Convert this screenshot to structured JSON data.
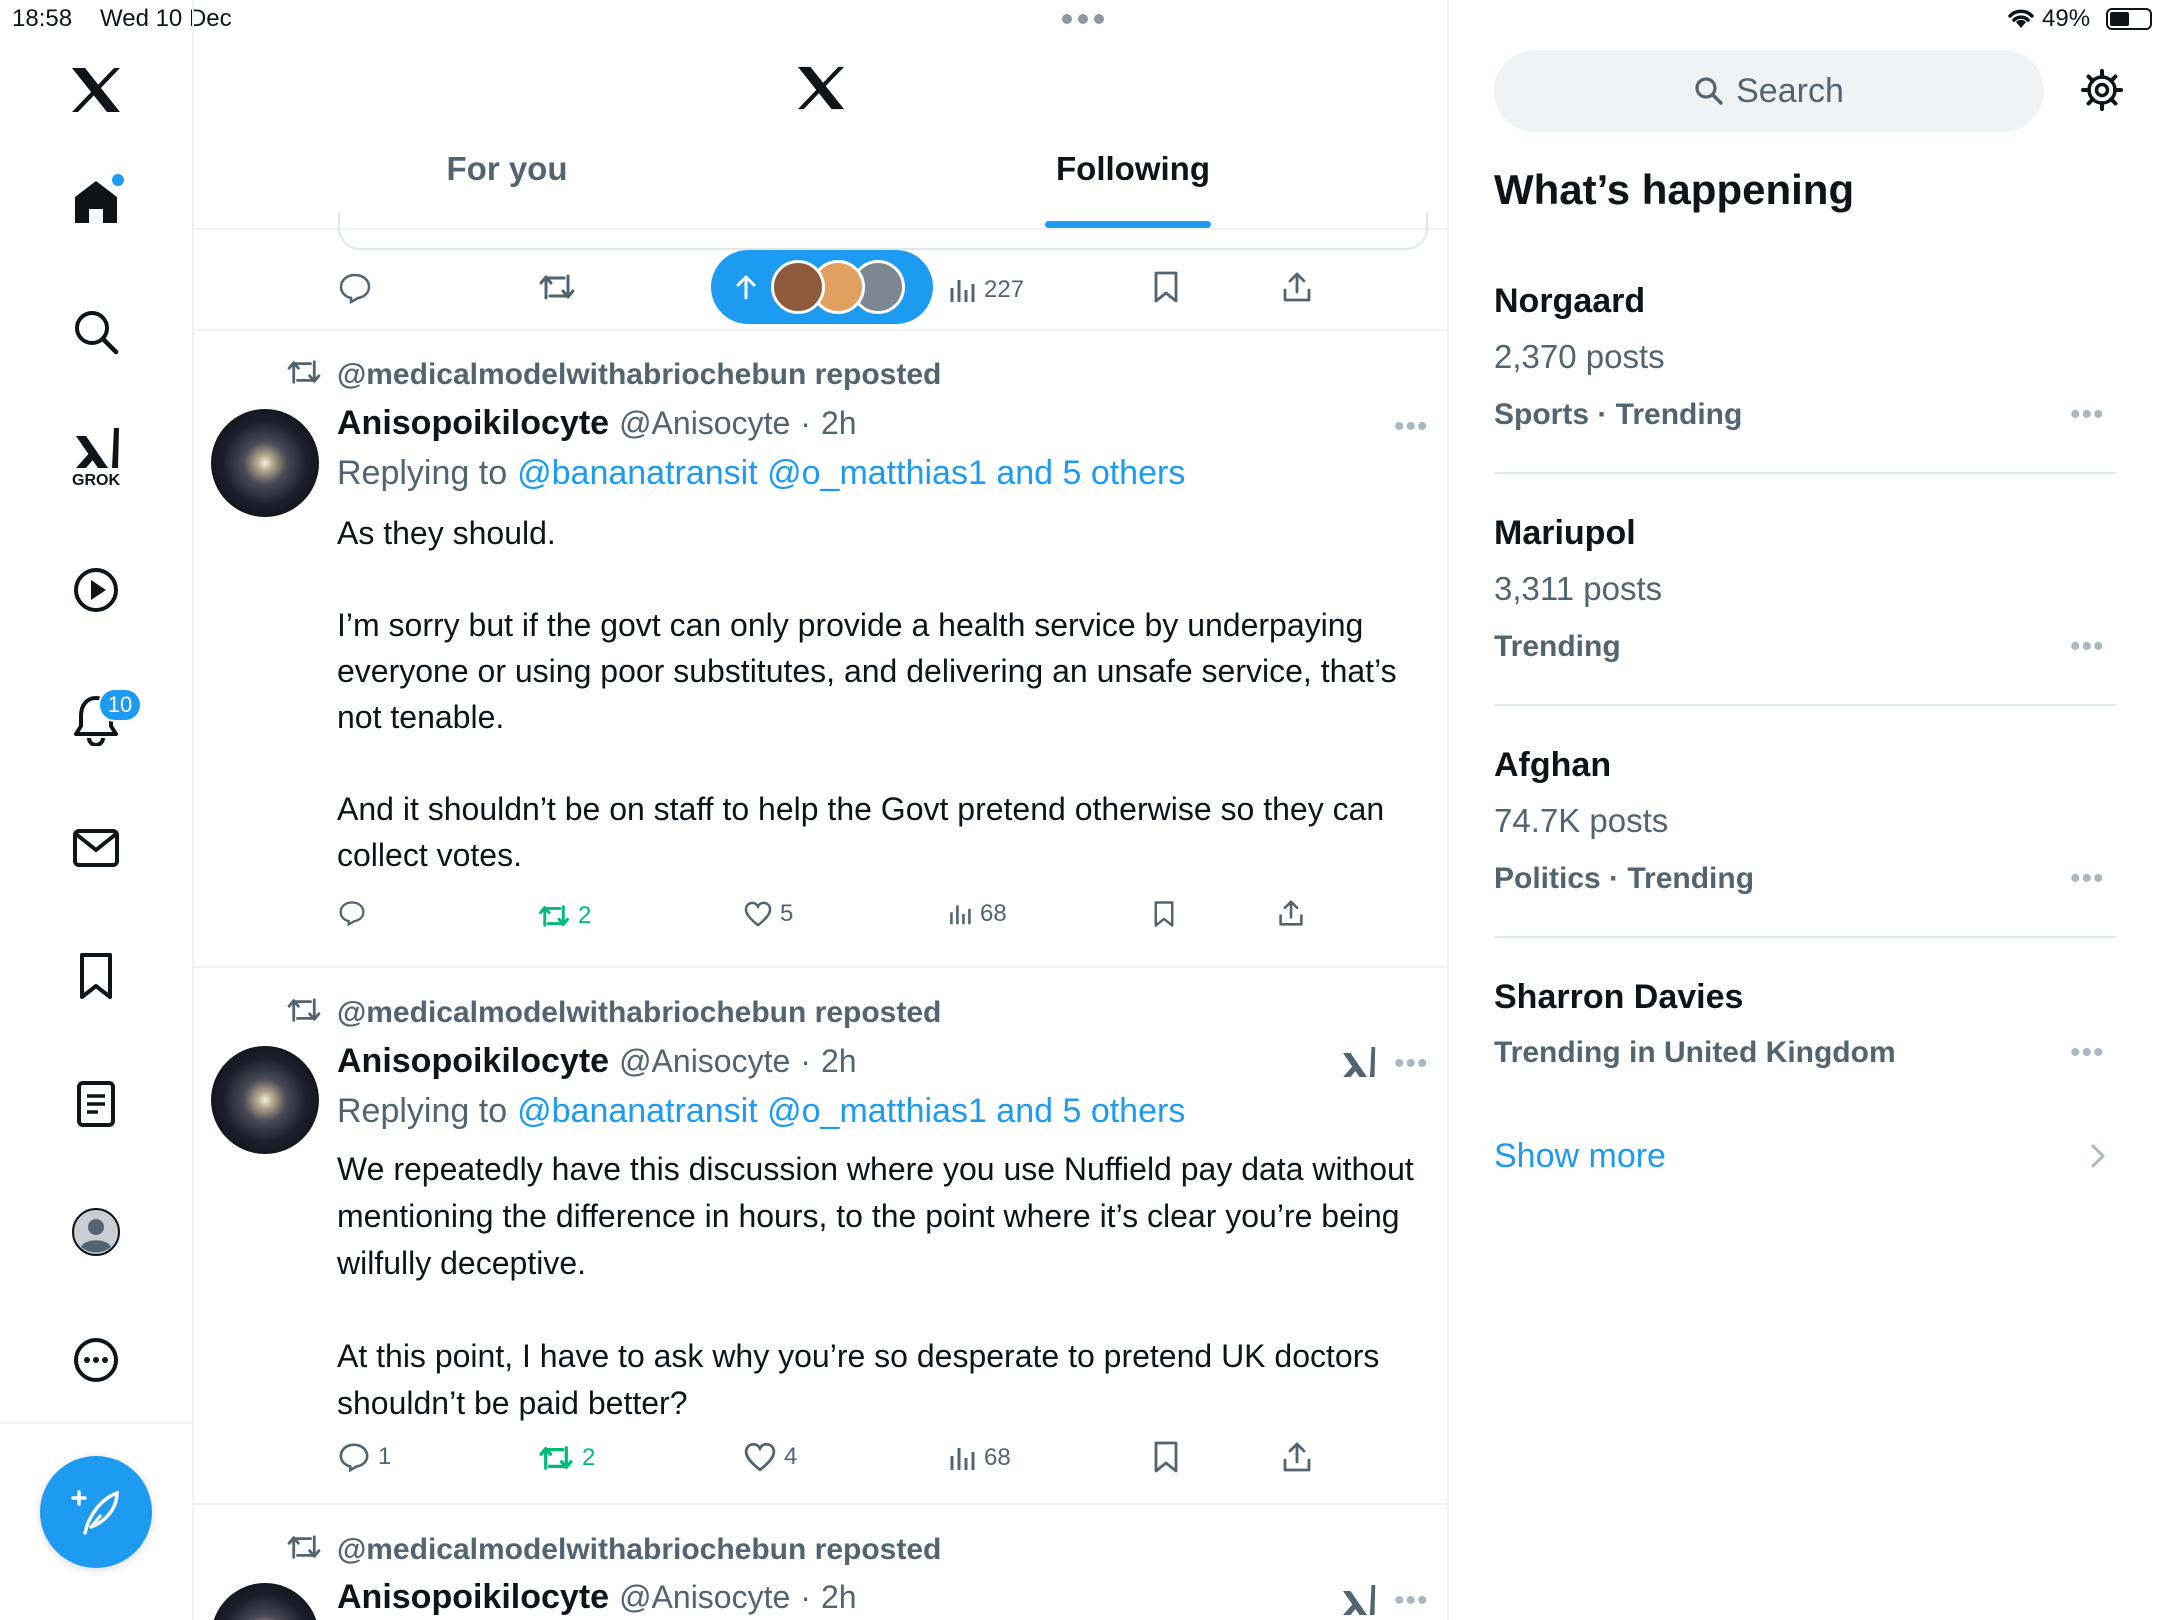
{
  "status_bar": {
    "time": "18:58",
    "date": "Wed 10 Dec",
    "battery": "49%"
  },
  "header": {
    "tabs": [
      {
        "label": "For you"
      },
      {
        "label": "Following",
        "active": true
      }
    ]
  },
  "sidebar": {
    "notification_count": "10",
    "grok_label": "GROK"
  },
  "top_actions": {
    "views": "227"
  },
  "posts": [
    {
      "repost_by": "@medicalmodelwithabriochebun reposted",
      "name": "Anisopoikilocyte",
      "handle": "@Anisocyte",
      "sep": "·",
      "time": "2h",
      "replying_prefix": "Replying to",
      "replying_to": "@bananatransit @o_matthias1 and 5 others",
      "paragraphs": [
        "As they should.",
        "I’m sorry but if the govt can only provide a health service by underpaying everyone or using poor substitutes, and delivering an unsafe service, that’s not tenable.",
        "And it shouldn’t be on staff to help the Govt pretend otherwise so they can collect votes."
      ],
      "replies": "",
      "reposts": "2",
      "likes": "5",
      "views": "68"
    },
    {
      "repost_by": "@medicalmodelwithabriochebun reposted",
      "name": "Anisopoikilocyte",
      "handle": "@Anisocyte",
      "sep": "·",
      "time": "2h",
      "replying_prefix": "Replying to",
      "replying_to": "@bananatransit @o_matthias1 and 5 others",
      "paragraphs": [
        "We repeatedly have this discussion where you use Nuffield pay data without mentioning the difference in hours, to the point where it’s clear you’re being wilfully deceptive.",
        "At this point, I have to ask why you’re so desperate to pretend UK doctors shouldn’t be paid better?"
      ],
      "replies": "1",
      "reposts": "2",
      "likes": "4",
      "views": "68"
    },
    {
      "repost_by": "@medicalmodelwithabriochebun reposted",
      "name": "Anisopoikilocyte",
      "handle": "@Anisocyte",
      "sep": "·",
      "time": "2h"
    }
  ],
  "right": {
    "search_placeholder": "Search",
    "section_title": "What’s happening",
    "trends": [
      {
        "title": "Norgaard",
        "count": "2,370 posts",
        "context": "Sports · Trending"
      },
      {
        "title": "Mariupol",
        "count": "3,311 posts",
        "context": "Trending"
      },
      {
        "title": "Afghan",
        "count": "74.7K posts",
        "context": "Politics · Trending"
      },
      {
        "title": "Sharron Davies",
        "context": "Trending in United Kingdom"
      }
    ],
    "show_more": "Show more"
  },
  "colors": {
    "accent": "#1d9bf0",
    "repost_green": "#00ba7c",
    "text": "#0f1419",
    "muted": "#536471",
    "border": "#eff3f4"
  }
}
